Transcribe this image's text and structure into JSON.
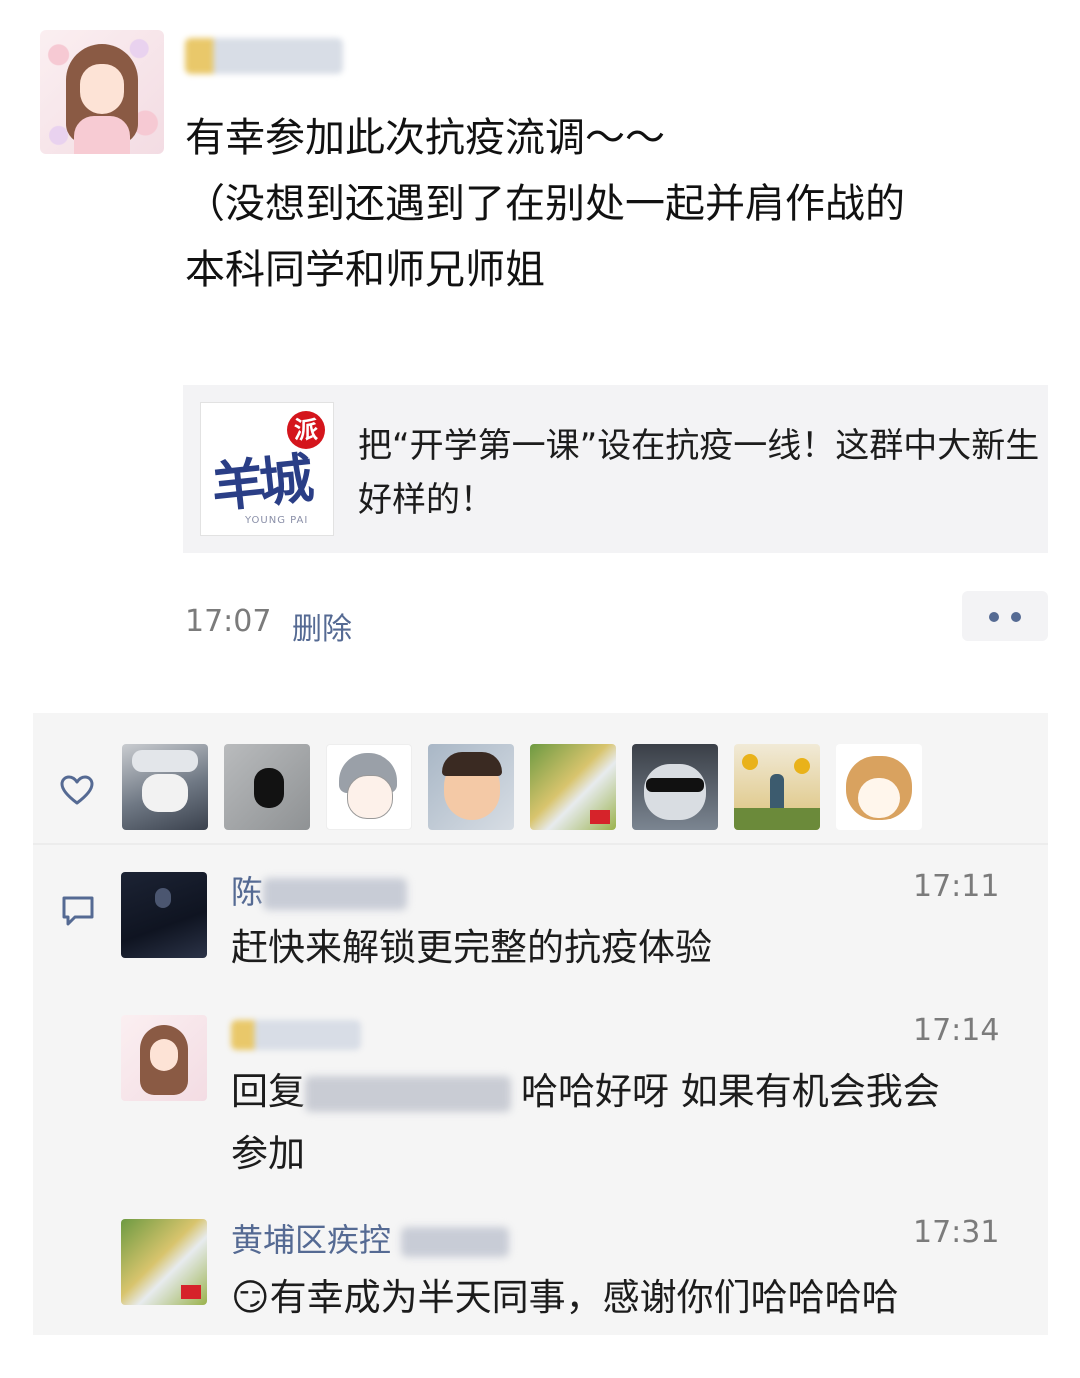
{
  "post": {
    "author_avatar": "girl-avatar",
    "text_line1": "有幸参加此次抗疫流调～～",
    "text_line2": "（没想到还遇到了在别处一起并肩作战的",
    "text_line3": "本科同学和师兄师姐",
    "share": {
      "logo_text": "羊城",
      "logo_seal": "派",
      "logo_sub": "YOUNG PAI",
      "title": "把“开学第一课”设在抗疫一线！这群中大新生好样的！"
    },
    "time": "17:07",
    "delete_label": "删除"
  },
  "likes": {
    "icon": "heart-icon",
    "avatars": [
      "ninja-avatar",
      "dark-cat-avatar",
      "anime-avatar",
      "child-avatar",
      "landscape-avatar",
      "sunglasses-cat-avatar",
      "sunflower-avatar",
      "shiba-avatar"
    ]
  },
  "comments": {
    "icon": "comment-icon",
    "items": [
      {
        "name": "陈",
        "time": "17:11",
        "text": "赶快来解锁更完整的抗疫体验"
      },
      {
        "name": "",
        "time": "17:14",
        "reply_prefix": "回复",
        "text_line1": "哈哈好呀 如果有机会我会",
        "text_line2": "参加"
      },
      {
        "name": "黄埔区疾控",
        "time": "17:31",
        "emoji": "😏",
        "text": "有幸成为半天同事，感谢你们哈哈哈哈"
      }
    ]
  },
  "colors": {
    "link": "#556a93",
    "panel": "#f5f5f5",
    "card": "#f3f3f5"
  }
}
